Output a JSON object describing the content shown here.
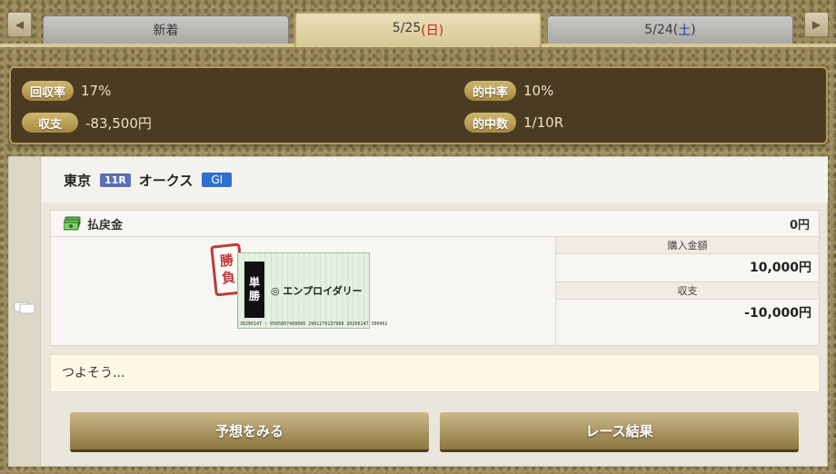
{
  "tabs": {
    "new_label": "新着",
    "active_date": "5/25",
    "active_day": "(日)",
    "sat_date": "5/24",
    "sat_day_open": "(",
    "sat_day": "土",
    "sat_day_close": ")"
  },
  "nav": {
    "prev_icon": "◀",
    "next_icon": "▶"
  },
  "summary": {
    "recovery_label": "回収率",
    "recovery_value": "17%",
    "balance_label": "収支",
    "balance_value": "-83,500円",
    "hit_rate_label": "的中率",
    "hit_rate_value": "10%",
    "hit_count_label": "的中数",
    "hit_count_value": "1/10R"
  },
  "race": {
    "venue": "東京",
    "race_no": "11R",
    "name": "オークス",
    "grade": "GI"
  },
  "payout": {
    "label": "払戻金",
    "amount": "0円"
  },
  "ticket": {
    "stamp": [
      "勝",
      "負"
    ],
    "bet_type": [
      "単",
      "勝"
    ],
    "horse": "◎ エンプロイダリー",
    "barcode": "30206147 · 05050074​68066 29012701​37989 30206147 300462"
  },
  "purchase": {
    "amount_label": "購入金額",
    "amount": "10,000円",
    "balance_label": "収支",
    "balance": "-10,000円"
  },
  "comment": "つよそう...",
  "buttons": {
    "predict": "予想をみる",
    "result": "レース結果"
  },
  "colors": {
    "sunday": "#c8251b",
    "saturday": "#1f3f9e",
    "grade_badge": "#2f6fd1",
    "race_badge": "#5b6fb5"
  }
}
